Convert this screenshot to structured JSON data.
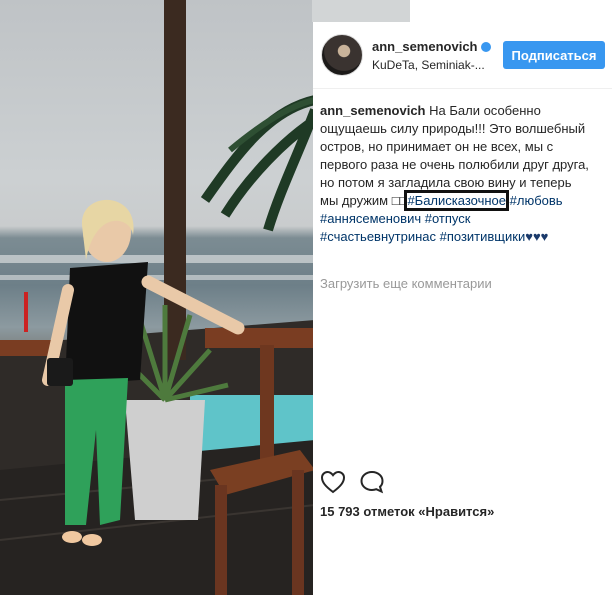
{
  "post": {
    "username": "ann_semenovich",
    "location": "KuDeTa, Seminiak-...",
    "follow_label": "Подписаться",
    "caption_text": "На Бали особенно ощущаешь силу природы!!! Это волшебный остров, но принимает он не всех, мы с первого раза не очень полюбили друг друга, но потом я загладила свою вину и теперь мы дружим ",
    "caption_glyphs": "□□",
    "hashtags": [
      "#Балисказочное",
      "#любовь",
      "#аннясеменович",
      "#отпуск",
      "#счастьевнутринас",
      "#позитивщики"
    ],
    "hearts": "♥♥♥",
    "load_more": "Загрузить еще комментарии",
    "likes_text": "15 793 отметок «Нравится»"
  },
  "icons": {
    "verified": "verified-badge-icon",
    "like": "heart-outline-icon",
    "comment": "comment-bubble-icon"
  },
  "colors": {
    "accent": "#3897f0",
    "hashtag": "#003569",
    "text": "#262626",
    "muted": "#999999"
  }
}
